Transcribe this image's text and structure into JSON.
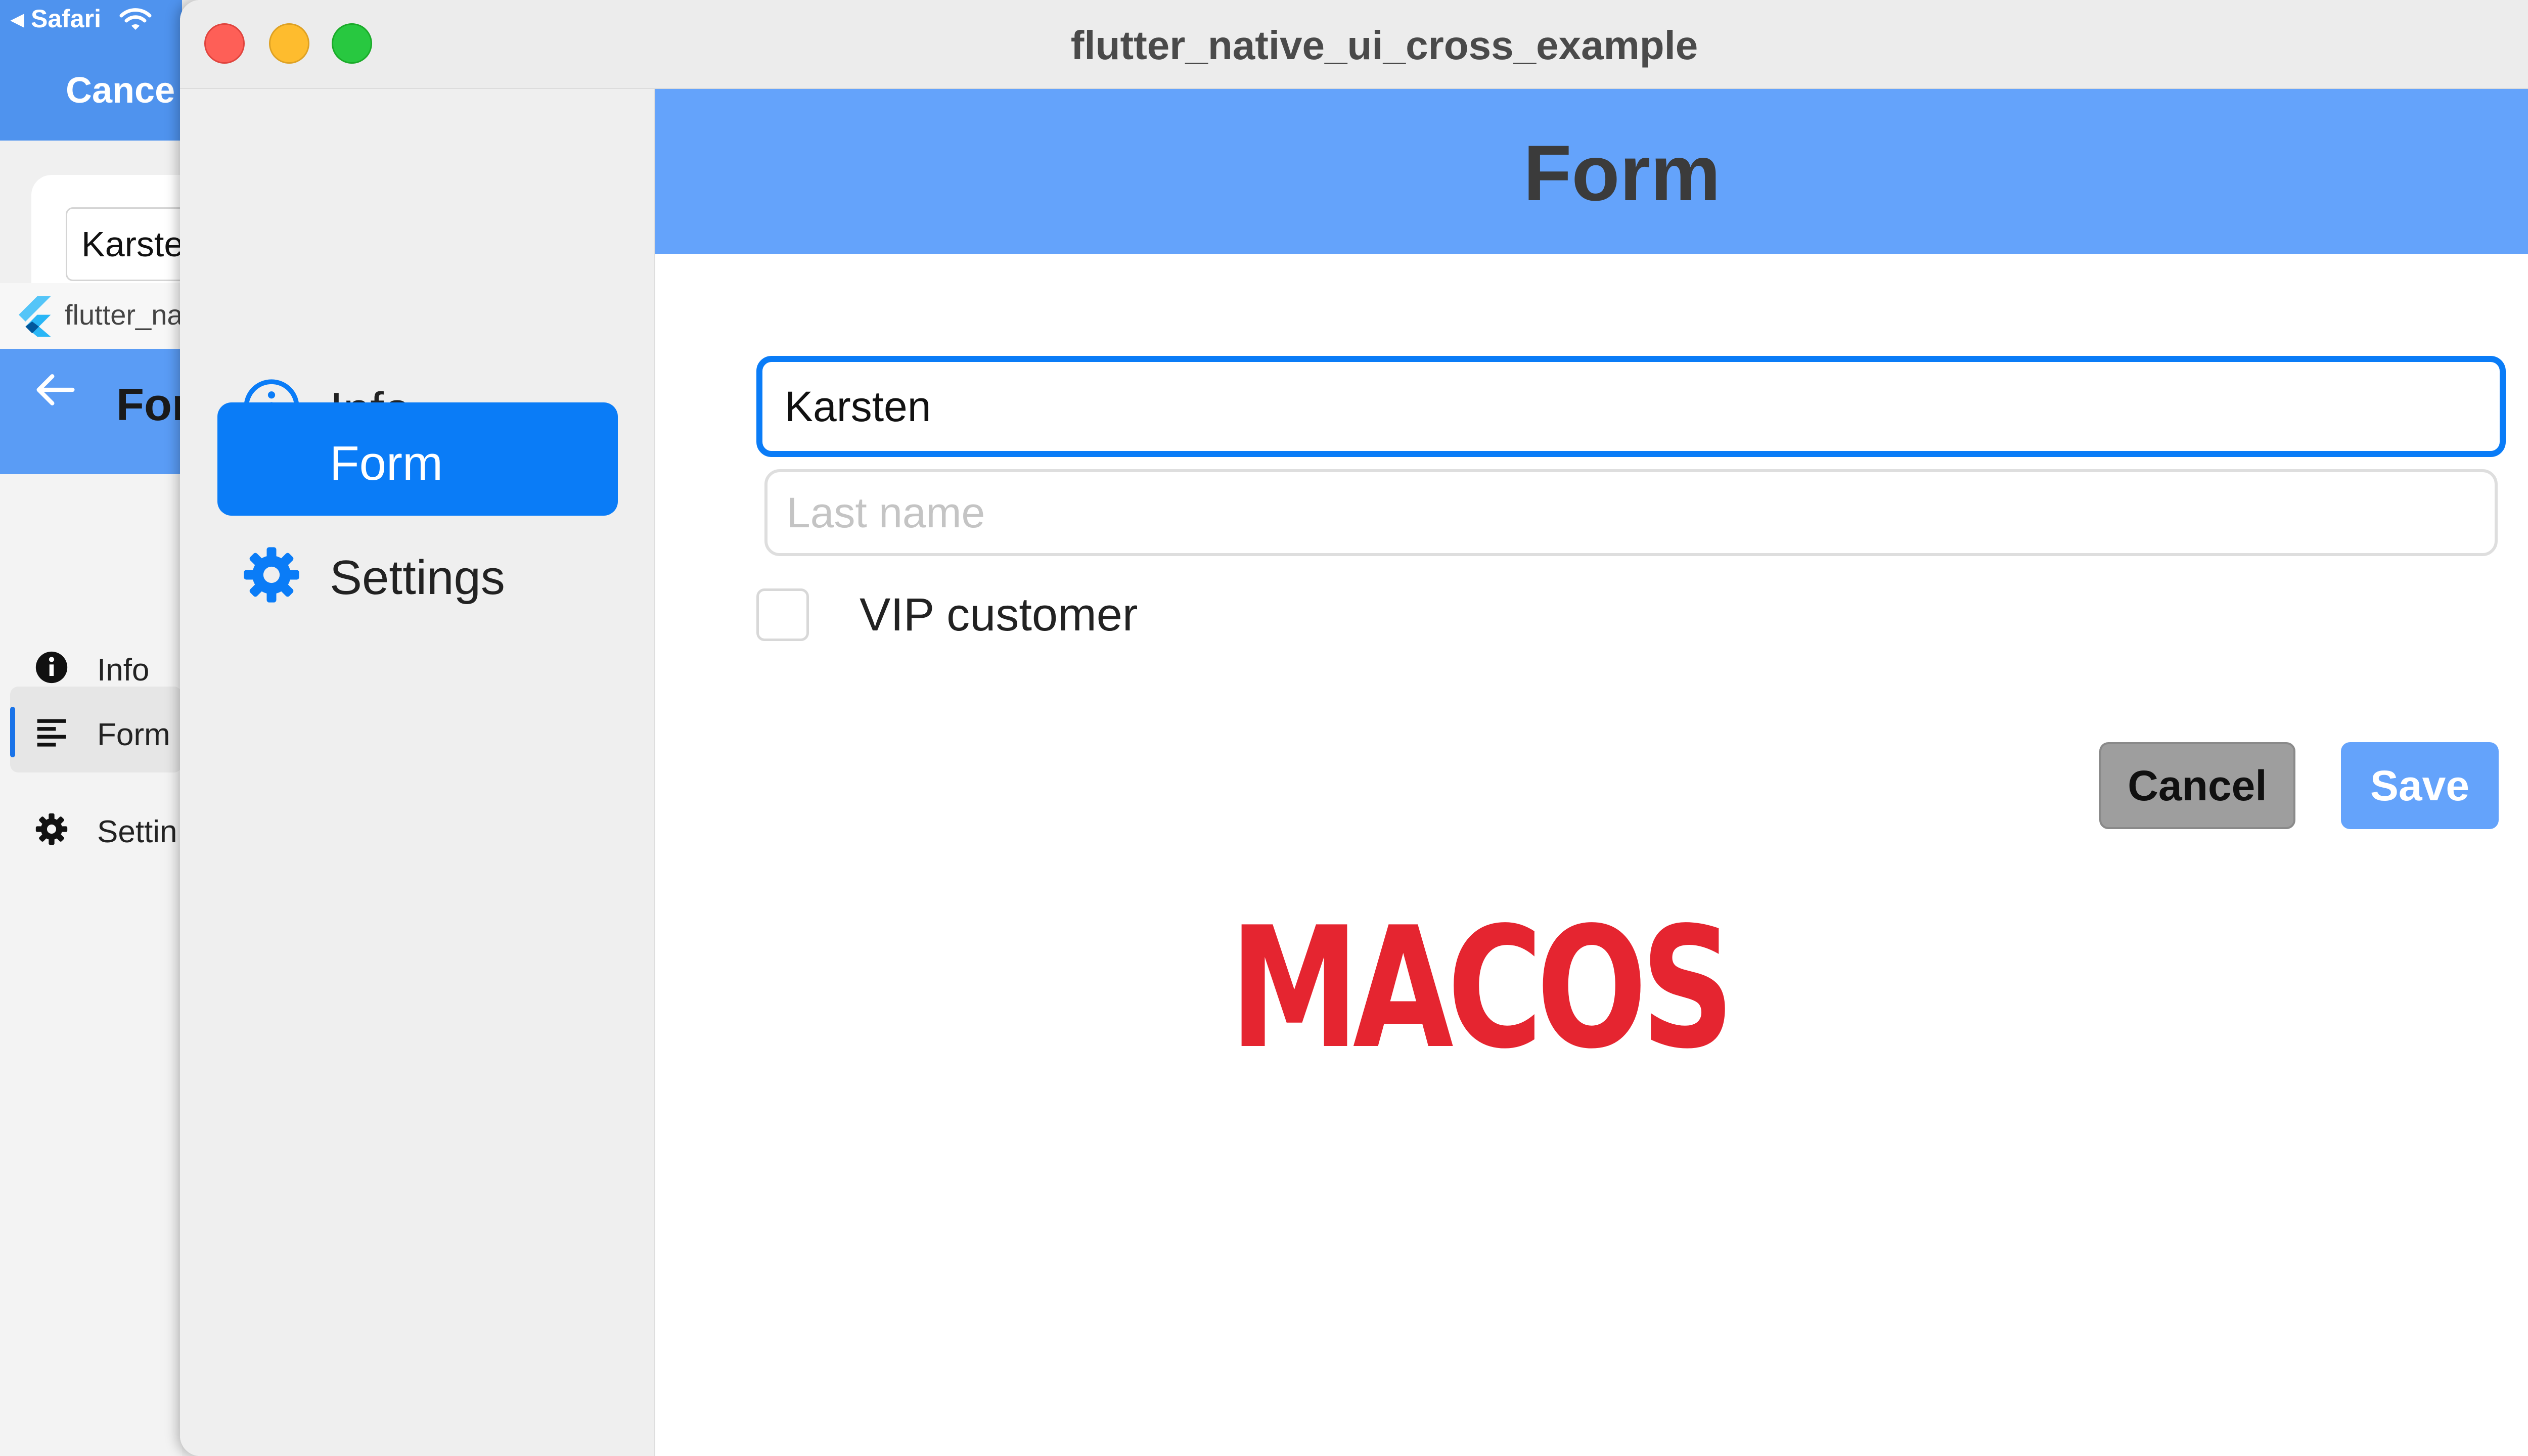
{
  "background_ios": {
    "status_text": "◂ Safari",
    "cancel_label": "Cance",
    "name_field_value": "Karste"
  },
  "background_windows": {
    "window_title": "flutter_na",
    "appbar_title": "For",
    "nav": [
      {
        "label": "Info",
        "icon": "info-icon"
      },
      {
        "label": "Form",
        "icon": "list-icon"
      },
      {
        "label": "Settin",
        "icon": "gear-icon"
      }
    ]
  },
  "mac_window": {
    "title": "flutter_native_ui_cross_example",
    "sidebar": [
      {
        "label": "Info",
        "icon": "info-circle-icon"
      },
      {
        "label": "Form"
      },
      {
        "label": "Settings",
        "icon": "gear-icon"
      }
    ],
    "content_title": "Form",
    "form": {
      "first_name_value": "Karsten",
      "last_name_placeholder": "Last name",
      "vip_label": "VIP customer",
      "cancel_label": "Cancel",
      "save_label": "Save"
    }
  },
  "overlay_label": "MACOS",
  "colors": {
    "accent": "#0a7cf7",
    "header_blue": "#64a3fb",
    "overlay_red": "#e52530"
  }
}
